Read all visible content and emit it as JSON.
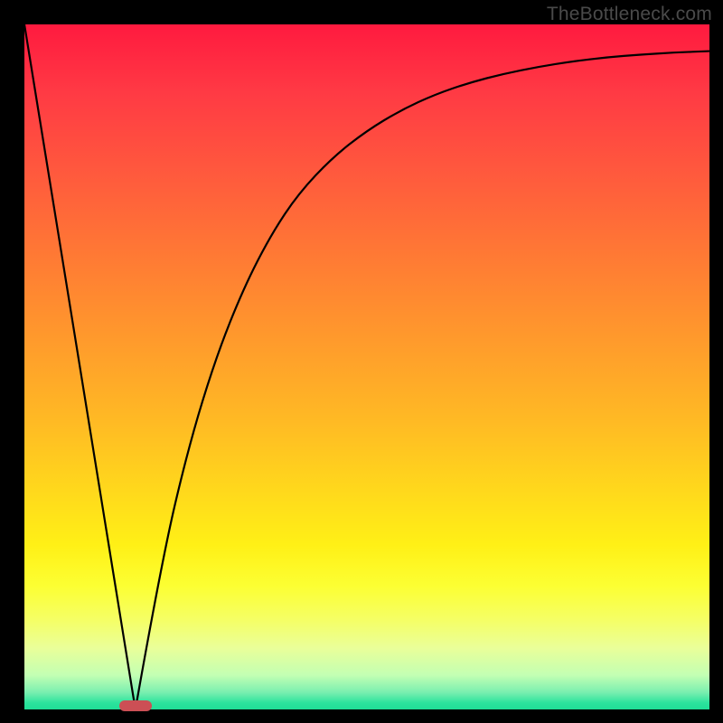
{
  "watermark": "TheBottleneck.com",
  "marker": {
    "x_frac": 0.162,
    "y_frac": 0.995,
    "color": "#cc4f55"
  },
  "chart_data": {
    "type": "line",
    "title": "",
    "xlabel": "",
    "ylabel": "",
    "xlim": [
      0,
      1
    ],
    "ylim": [
      0,
      1
    ],
    "series": [
      {
        "name": "left-branch",
        "x": [
          0.0,
          0.162
        ],
        "y": [
          1.0,
          0.0
        ]
      },
      {
        "name": "right-branch",
        "x": [
          0.162,
          0.2,
          0.24,
          0.28,
          0.32,
          0.36,
          0.4,
          0.45,
          0.5,
          0.55,
          0.6,
          0.65,
          0.7,
          0.75,
          0.8,
          0.85,
          0.9,
          0.95,
          1.0
        ],
        "y": [
          0.0,
          0.215,
          0.385,
          0.515,
          0.615,
          0.693,
          0.753,
          0.806,
          0.845,
          0.875,
          0.898,
          0.915,
          0.928,
          0.938,
          0.946,
          0.952,
          0.956,
          0.959,
          0.961
        ]
      }
    ],
    "annotations": [],
    "legend": false,
    "grid": false
  },
  "colors": {
    "gradient_top": "#ff1a3f",
    "gradient_mid": "#ffd81c",
    "gradient_bottom": "#1fdd96",
    "curve": "#000000",
    "frame": "#000000"
  }
}
